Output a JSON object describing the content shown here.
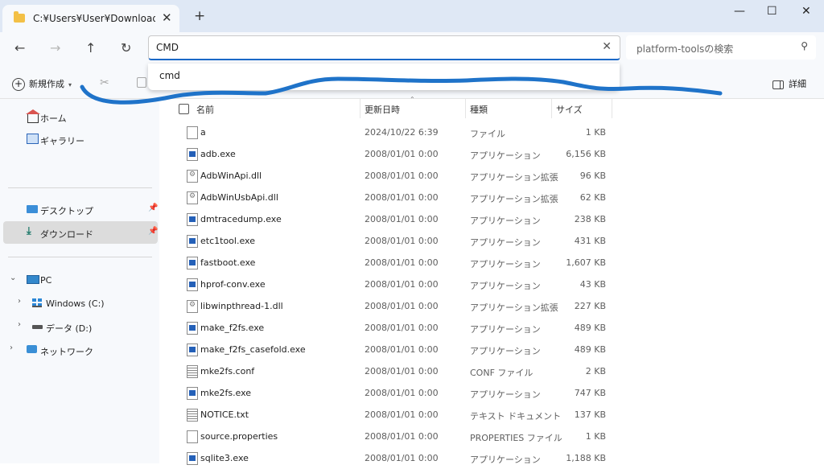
{
  "window": {
    "tab_title": "C:¥Users¥User¥Downloads¥platform-tools",
    "close_tab": "✕",
    "new_tab": "+",
    "minimize": "—",
    "maximize": "☐",
    "close": "✕"
  },
  "nav": {
    "back": "←",
    "forward": "→",
    "up": "↑",
    "refresh": "↻"
  },
  "address": {
    "value": "CMD",
    "clear": "✕",
    "suggestion": "cmd"
  },
  "search": {
    "placeholder": "platform-toolsの検索",
    "icon": "search-icon"
  },
  "commandbar": {
    "new_label": "新規作成",
    "details_label": "詳細"
  },
  "sidebar": {
    "items": [
      {
        "label": "ホーム",
        "icon": "home-icon"
      },
      {
        "label": "ギャラリー",
        "icon": "gallery-icon"
      },
      {
        "label": "デスクトップ",
        "icon": "desktop-icon",
        "pinned": true
      },
      {
        "label": "ダウンロード",
        "icon": "download-icon",
        "pinned": true,
        "selected": true
      },
      {
        "label": "PC",
        "icon": "pc-icon",
        "expanded": true
      },
      {
        "label": "Windows (C:)",
        "icon": "windows-drive-icon"
      },
      {
        "label": "データ (D:)",
        "icon": "drive-icon"
      },
      {
        "label": "ネットワーク",
        "icon": "network-icon"
      }
    ]
  },
  "columns": {
    "name": "名前",
    "date": "更新日時",
    "type": "種類",
    "size": "サイズ"
  },
  "files": [
    {
      "name": "a",
      "date": "2024/10/22 6:39",
      "type": "ファイル",
      "size": "1 KB",
      "icon": "file"
    },
    {
      "name": "adb.exe",
      "date": "2008/01/01 0:00",
      "type": "アプリケーション",
      "size": "6,156 KB",
      "icon": "exe"
    },
    {
      "name": "AdbWinApi.dll",
      "date": "2008/01/01 0:00",
      "type": "アプリケーション拡張",
      "size": "96 KB",
      "icon": "dll"
    },
    {
      "name": "AdbWinUsbApi.dll",
      "date": "2008/01/01 0:00",
      "type": "アプリケーション拡張",
      "size": "62 KB",
      "icon": "dll"
    },
    {
      "name": "dmtracedump.exe",
      "date": "2008/01/01 0:00",
      "type": "アプリケーション",
      "size": "238 KB",
      "icon": "exe"
    },
    {
      "name": "etc1tool.exe",
      "date": "2008/01/01 0:00",
      "type": "アプリケーション",
      "size": "431 KB",
      "icon": "exe"
    },
    {
      "name": "fastboot.exe",
      "date": "2008/01/01 0:00",
      "type": "アプリケーション",
      "size": "1,607 KB",
      "icon": "exe"
    },
    {
      "name": "hprof-conv.exe",
      "date": "2008/01/01 0:00",
      "type": "アプリケーション",
      "size": "43 KB",
      "icon": "exe"
    },
    {
      "name": "libwinpthread-1.dll",
      "date": "2008/01/01 0:00",
      "type": "アプリケーション拡張",
      "size": "227 KB",
      "icon": "dll"
    },
    {
      "name": "make_f2fs.exe",
      "date": "2008/01/01 0:00",
      "type": "アプリケーション",
      "size": "489 KB",
      "icon": "exe"
    },
    {
      "name": "make_f2fs_casefold.exe",
      "date": "2008/01/01 0:00",
      "type": "アプリケーション",
      "size": "489 KB",
      "icon": "exe"
    },
    {
      "name": "mke2fs.conf",
      "date": "2008/01/01 0:00",
      "type": "CONF ファイル",
      "size": "2 KB",
      "icon": "txt"
    },
    {
      "name": "mke2fs.exe",
      "date": "2008/01/01 0:00",
      "type": "アプリケーション",
      "size": "747 KB",
      "icon": "exe"
    },
    {
      "name": "NOTICE.txt",
      "date": "2008/01/01 0:00",
      "type": "テキスト ドキュメント",
      "size": "137 KB",
      "icon": "txt"
    },
    {
      "name": "source.properties",
      "date": "2008/01/01 0:00",
      "type": "PROPERTIES ファイル",
      "size": "1 KB",
      "icon": "file"
    },
    {
      "name": "sqlite3.exe",
      "date": "2008/01/01 0:00",
      "type": "アプリケーション",
      "size": "1,188 KB",
      "icon": "exe"
    }
  ],
  "colors": {
    "accent": "#1a68c7",
    "annotation": "#1f73c9",
    "selected": "#dcdcdc"
  }
}
